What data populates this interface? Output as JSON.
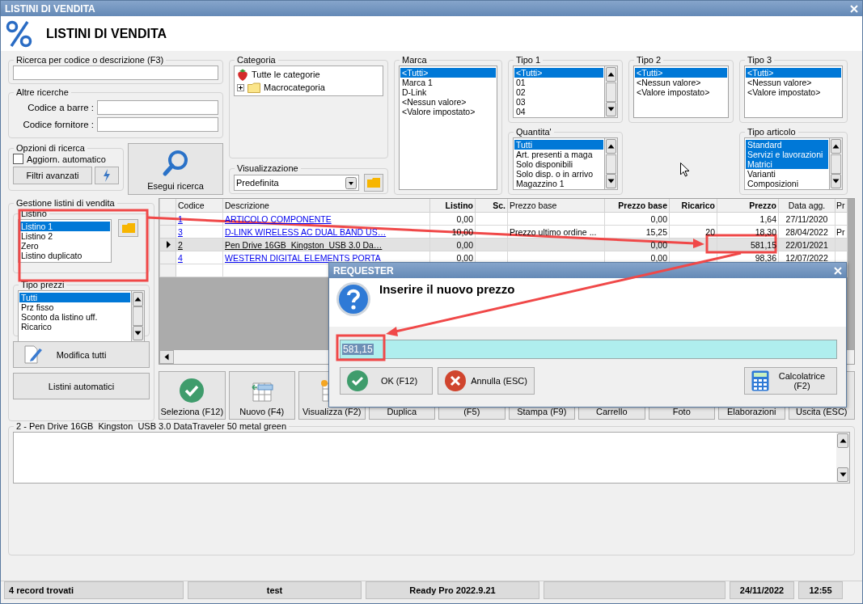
{
  "window": {
    "title": "LISTINI DI VENDITA"
  },
  "header": {
    "title": "LISTINI DI VENDITA"
  },
  "search": {
    "label": "Ricerca per codice o descrizione (F3)"
  },
  "other_searches": {
    "label": "Altre ricerche",
    "fields": [
      {
        "label": "Codice a barre :"
      },
      {
        "label": "Codice fornitore :"
      }
    ]
  },
  "search_options": {
    "label": "Opzioni di ricerca",
    "auto_update": {
      "label": "Aggiorn. automatico",
      "checked": false
    },
    "advanced_button": "Filtri avanzati"
  },
  "run_search_button": "Esegui ricerca",
  "category": {
    "label": "Categoria",
    "items": [
      {
        "label": "Tutte le categorie",
        "kind": "all"
      },
      {
        "label": "Macrocategoria",
        "kind": "folder",
        "expanded": false
      }
    ]
  },
  "view": {
    "label": "Visualizzazione",
    "value": "Predefinita"
  },
  "filters": {
    "brand": {
      "label": "Marca",
      "kind": "plain",
      "items": [
        {
          "label": "<Tutti>",
          "selected": true
        },
        {
          "label": "Marca 1",
          "selected": false
        },
        {
          "label": "D-Link",
          "selected": false
        },
        {
          "label": "<Nessun valore>",
          "selected": false
        },
        {
          "label": "<Valore impostato>",
          "selected": false
        }
      ]
    },
    "type1": {
      "label": "Tipo 1",
      "kind": "scrolling",
      "items": [
        {
          "label": "<Tutti>",
          "selected": true
        },
        {
          "label": "01",
          "selected": false
        },
        {
          "label": "02",
          "selected": false
        },
        {
          "label": "03",
          "selected": false
        },
        {
          "label": "04",
          "selected": false
        }
      ]
    },
    "type2": {
      "label": "Tipo 2",
      "kind": "plain",
      "items": [
        {
          "label": "<Tutti>",
          "selected": true
        },
        {
          "label": "<Nessun valore>",
          "selected": false
        },
        {
          "label": "<Valore impostato>",
          "selected": false
        }
      ]
    },
    "type3": {
      "label": "Tipo 3",
      "kind": "plain",
      "items": [
        {
          "label": "<Tutti>",
          "selected": true
        },
        {
          "label": "<Nessun valore>",
          "selected": false
        },
        {
          "label": "<Valore impostato>",
          "selected": false
        }
      ]
    },
    "quantity": {
      "label": "Quantita'",
      "kind": "scrolling",
      "items": [
        {
          "label": "Tutti",
          "selected": true
        },
        {
          "label": "Art. presenti a maga",
          "selected": false
        },
        {
          "label": "Solo disponibili",
          "selected": false
        },
        {
          "label": "Solo disp. o in arrivo",
          "selected": false
        },
        {
          "label": "Magazzino 1",
          "selected": false
        }
      ]
    },
    "item_type": {
      "label": "Tipo articolo",
      "kind": "scrolling",
      "items": [
        {
          "label": "Standard",
          "selected": true
        },
        {
          "label": "Servizi e lavorazioni",
          "selected": true
        },
        {
          "label": "Matrici",
          "selected": true
        },
        {
          "label": "Varianti",
          "selected": false
        },
        {
          "label": "Composizioni",
          "selected": false
        }
      ]
    }
  },
  "pricelists": {
    "label": "Gestione listini di vendita",
    "listino": {
      "label": "Listino",
      "items": [
        {
          "label": "Listino 1",
          "selected": true
        },
        {
          "label": "Listino 2",
          "selected": false
        },
        {
          "label": "Zero",
          "selected": false
        },
        {
          "label": "Listino duplicato",
          "selected": false
        }
      ]
    },
    "price_types": {
      "label": "Tipo prezzi",
      "items": [
        {
          "label": "Tutti",
          "selected": true
        },
        {
          "label": "Prz fisso",
          "selected": false
        },
        {
          "label": "Sconto da listino uff.",
          "selected": false
        },
        {
          "label": "Ricarico",
          "selected": false
        }
      ]
    },
    "buttons": [
      {
        "label": "Modifica tutti",
        "kind": "edit"
      },
      {
        "label": "Listini automatici",
        "kind": "plain"
      }
    ]
  },
  "table": {
    "columns": [
      {
        "label": "Codice",
        "kind": "link"
      },
      {
        "label": "Descrizione",
        "kind": "link"
      },
      {
        "label": "Listino",
        "kind": "numeric"
      },
      {
        "label": "Sc.",
        "kind": "numeric"
      },
      {
        "label": "Prezzo base",
        "kind": "text"
      },
      {
        "label": "Prezzo base",
        "kind": "numeric"
      },
      {
        "label": "Ricarico",
        "kind": "numeric"
      },
      {
        "label": "Prezzo",
        "kind": "numeric"
      },
      {
        "label": "Data agg.",
        "kind": "date"
      },
      {
        "label": "Pr",
        "kind": "text"
      }
    ],
    "rows": [
      {
        "current": false,
        "cells": [
          "1",
          "ARTICOLO COMPONENTE",
          "0,00",
          null,
          null,
          "0,00",
          null,
          "1,64",
          "27/11/2020",
          null
        ]
      },
      {
        "current": false,
        "cells": [
          "3",
          "D-LINK WIRELESS AC DUAL BAND US…",
          "10,00",
          null,
          "Prezzo ultimo ordine ...",
          "15,25",
          "20",
          "18,30",
          "28/04/2022",
          "Pr"
        ]
      },
      {
        "current": true,
        "cells": [
          "2",
          "Pen Drive 16GB  Kingston  USB 3.0 Da…",
          "0,00",
          null,
          null,
          "0,00",
          null,
          "581,15",
          "22/01/2021",
          null
        ]
      },
      {
        "current": false,
        "cells": [
          "4",
          "WESTERN DIGITAL ELEMENTS PORTA",
          "0,00",
          null,
          null,
          "0,00",
          null,
          "98,36",
          "12/07/2022",
          null
        ]
      }
    ]
  },
  "toolbar": [
    {
      "label": "Seleziona (F12)",
      "kind": "select"
    },
    {
      "label": "Nuovo (F4)",
      "kind": "new"
    },
    {
      "label": "Visualizza (F2)",
      "kind": "view"
    },
    {
      "label": "Duplica",
      "kind": "plain"
    },
    {
      "label": "(F5)",
      "kind": "plain"
    },
    {
      "label": "Stampa (F9)",
      "kind": "plain"
    },
    {
      "label": "Carrello",
      "kind": "plain"
    },
    {
      "label": "Foto",
      "kind": "plain"
    },
    {
      "label": "Elaborazioni",
      "kind": "plain"
    },
    {
      "label": "Uscita (ESC)",
      "kind": "plain"
    }
  ],
  "details": {
    "label": "2 - Pen Drive 16GB  Kingston  USB 3.0 DataTraveler 50 metal green"
  },
  "status_bar": [
    {
      "text": "4 record trovati",
      "kind": "info"
    },
    {
      "text": "test",
      "kind": "user"
    },
    {
      "text": "Ready Pro 2022.9.21",
      "kind": "version"
    },
    {
      "kind": "blank"
    },
    {
      "text": "24/11/2022",
      "kind": "date"
    },
    {
      "text": "12:55",
      "kind": "time"
    }
  ],
  "dialog": {
    "title": "REQUESTER",
    "message": "Inserire il nuovo prezzo",
    "value": "581,15",
    "buttons": [
      {
        "label": "OK (F12)",
        "kind": "ok"
      },
      {
        "label": "Annulla (ESC)",
        "kind": "cancel"
      },
      {
        "label": "Calcolatrice (F2)",
        "kind": "calculator"
      }
    ]
  }
}
